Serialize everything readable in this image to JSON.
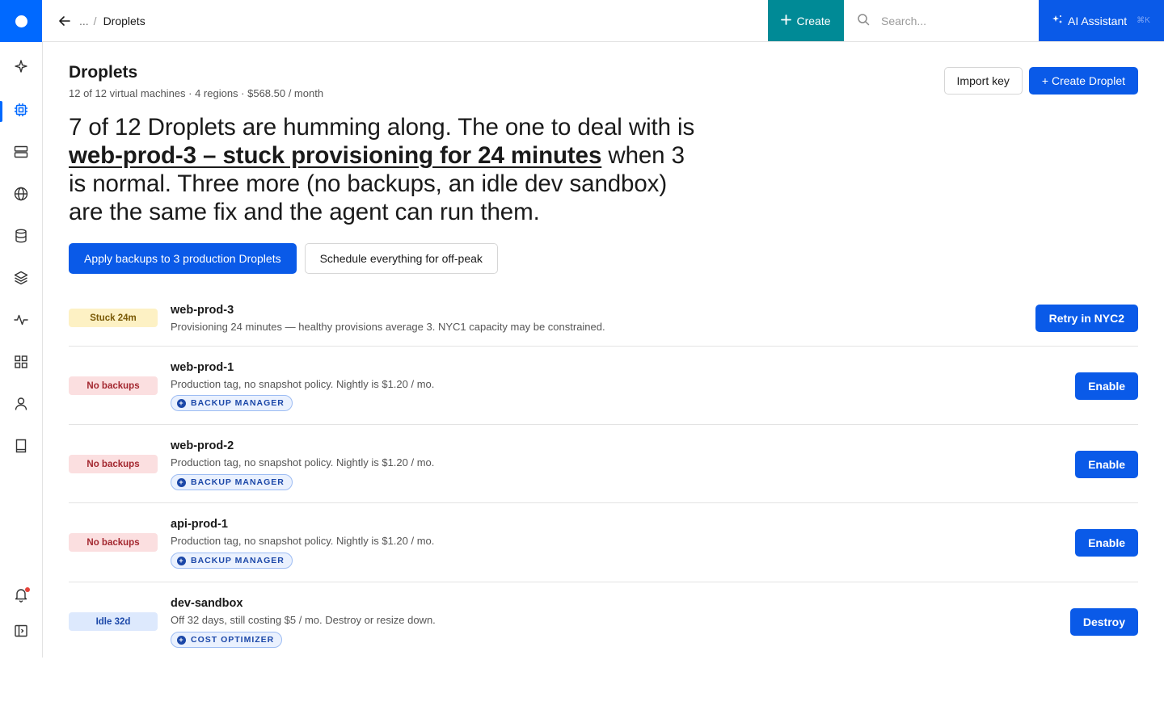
{
  "topbar": {
    "breadcrumb_ellipsis": "...",
    "breadcrumb_sep": "/",
    "breadcrumb_current": "Droplets",
    "create_label": "Create",
    "search_placeholder": "Search...",
    "ai_label": "AI Assistant",
    "ai_shortcut": "⌘K"
  },
  "sidebar": {
    "items": [
      {
        "icon": "sparkle-icon"
      },
      {
        "icon": "chip-icon",
        "active": true
      },
      {
        "icon": "server-stack-icon"
      },
      {
        "icon": "globe-icon"
      },
      {
        "icon": "database-icon"
      },
      {
        "icon": "layers-icon"
      },
      {
        "icon": "activity-icon"
      },
      {
        "icon": "grid-icon"
      },
      {
        "icon": "user-icon"
      },
      {
        "icon": "book-icon"
      }
    ],
    "bottom": [
      {
        "icon": "bell-icon"
      },
      {
        "icon": "panel-toggle-icon"
      }
    ]
  },
  "page": {
    "title": "Droplets",
    "subtitle": "12 of 12 virtual machines · 4 regions · $568.50 / month",
    "import_key_label": "Import key",
    "create_droplet_label": "+ Create Droplet"
  },
  "summary": {
    "part1": "7 of 12 Droplets are humming along. The one to deal with is ",
    "highlight": "web-prod-3 – stuck provisioning for 24 minutes",
    "part2": " when 3 is normal. Three more (no backups, an idle dev sandbox) are the same fix and the agent can run them."
  },
  "cta": {
    "primary": "Apply backups to 3 production Droplets",
    "secondary": "Schedule everything for off-peak"
  },
  "rows": [
    {
      "badge": "Stuck 24m",
      "name": "web-prod-3",
      "desc": "Provisioning 24 minutes — healthy provisions average 3. NYC1 capacity may be constrained.",
      "chip": "",
      "action": "Retry in NYC2"
    },
    {
      "badge": "No backups",
      "name": "web-prod-1",
      "desc": "Production tag, no snapshot policy. Nightly is $1.20 / mo.",
      "chip": "BACKUP MANAGER",
      "action": "Enable"
    },
    {
      "badge": "No backups",
      "name": "web-prod-2",
      "desc": "Production tag, no snapshot policy. Nightly is $1.20 / mo.",
      "chip": "BACKUP MANAGER",
      "action": "Enable"
    },
    {
      "badge": "No backups",
      "name": "api-prod-1",
      "desc": "Production tag, no snapshot policy. Nightly is $1.20 / mo.",
      "chip": "BACKUP MANAGER",
      "action": "Enable"
    },
    {
      "badge": "Idle 32d",
      "name": "dev-sandbox",
      "desc": "Off 32 days, still costing $5 / mo. Destroy or resize down.",
      "chip": "COST OPTIMIZER",
      "action": "Destroy"
    }
  ],
  "colors": {
    "brand": "#0069ff",
    "primary_button": "#0a5ae8",
    "create_button": "#008a96",
    "warn_badge_bg": "#fdf1c4",
    "danger_badge_bg": "#fbdfe0",
    "info_badge_bg": "#dde9fd"
  }
}
